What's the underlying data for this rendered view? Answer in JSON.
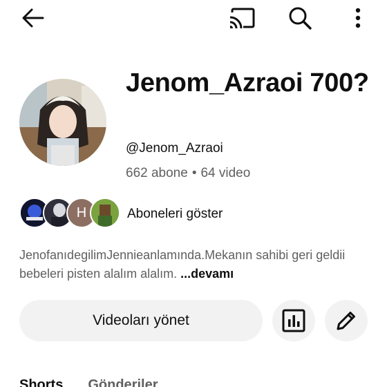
{
  "header": {
    "back_icon": "arrow-back-icon",
    "cast_icon": "cast-icon",
    "search_icon": "search-icon",
    "more_icon": "more-vert-icon"
  },
  "channel": {
    "name": "Jenom_Azraoi 700?",
    "handle": "@Jenom_Azraoi",
    "subscriber_count": "662 abone",
    "separator": "•",
    "video_count": "64 video"
  },
  "subscribers": {
    "label": "Aboneleri göster",
    "avatars": [
      {
        "type": "image"
      },
      {
        "type": "image"
      },
      {
        "type": "letter",
        "letter": "H",
        "color": "#8d6e63"
      },
      {
        "type": "image"
      }
    ]
  },
  "description": {
    "text": "JenofanıdegilimJennieanlamında.Mekanın sahibi geri geldii bebeleri pisten alalım alalım. ",
    "more_label": "...devamı"
  },
  "actions": {
    "manage_videos_label": "Videoları yönet",
    "stats_icon": "analytics-icon",
    "edit_icon": "pencil-edit-icon"
  },
  "tabs": [
    {
      "label": "Shorts"
    },
    {
      "label": "Gönderiler"
    }
  ],
  "colors": {
    "text_primary": "#0f0f0f",
    "text_secondary": "#606060",
    "button_bg": "#f2f2f2"
  }
}
